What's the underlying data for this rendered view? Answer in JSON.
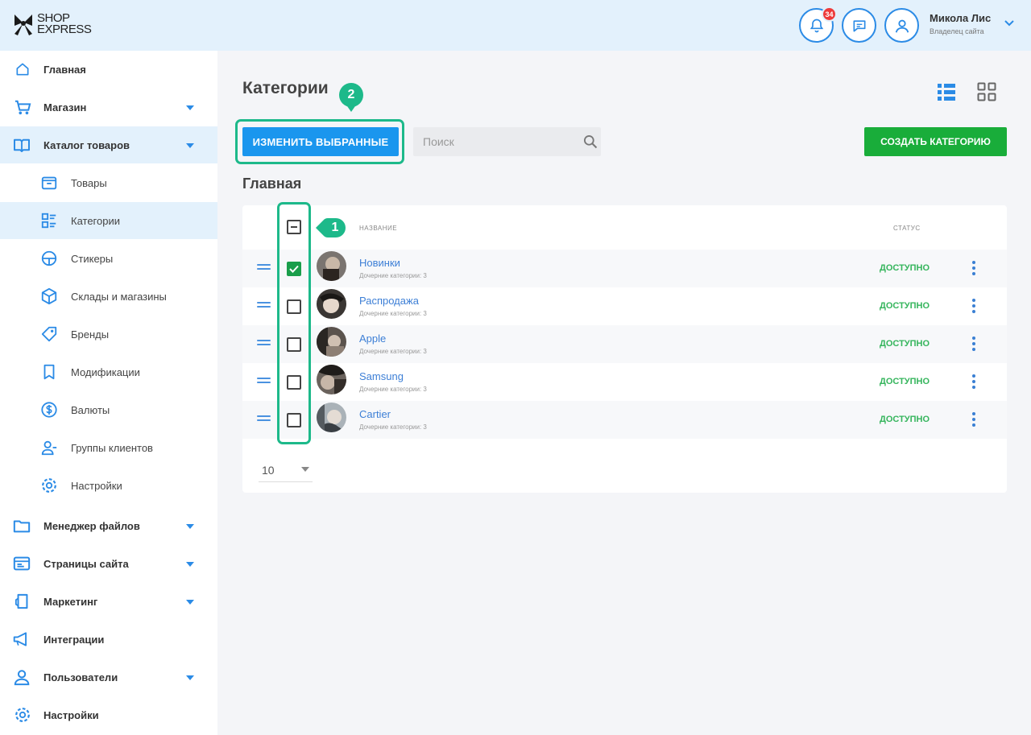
{
  "header": {
    "logo_line1": "SHOP",
    "logo_line2": "EXPRESS",
    "notifications_count": "34",
    "user_name": "Микола Лис",
    "user_role": "Владелец сайта",
    "icons": [
      "bell-icon",
      "chat-icon",
      "user-icon",
      "chevron-down-icon"
    ]
  },
  "sidebar": {
    "items": [
      {
        "label": "Главная",
        "icon": "home-icon"
      },
      {
        "label": "Магазин",
        "icon": "cart-icon"
      },
      {
        "label": "Каталог товаров",
        "icon": "book-icon"
      },
      {
        "label": "Товары",
        "icon": "box-icon"
      },
      {
        "label": "Категории",
        "icon": "categories-icon"
      },
      {
        "label": "Стикеры",
        "icon": "sticker-icon"
      },
      {
        "label": "Склады и магазины",
        "icon": "warehouse-icon"
      },
      {
        "label": "Бренды",
        "icon": "tag-icon"
      },
      {
        "label": "Модификации",
        "icon": "bookmark-icon"
      },
      {
        "label": "Валюты",
        "icon": "dollar-icon"
      },
      {
        "label": "Группы клиентов",
        "icon": "users-icon"
      },
      {
        "label": "Настройки",
        "icon": "gear-icon"
      },
      {
        "label": "Менеджер файлов",
        "icon": "folder-icon"
      },
      {
        "label": "Страницы сайта",
        "icon": "page-icon"
      },
      {
        "label": "Маркетинг",
        "icon": "marketing-icon"
      },
      {
        "label": "Интеграции",
        "icon": "megaphone-icon"
      },
      {
        "label": "Пользователи",
        "icon": "user-icon"
      },
      {
        "label": "Настройки",
        "icon": "gear-icon"
      }
    ]
  },
  "main": {
    "title": "Категории",
    "edit_selected_label": "ИЗМЕНИТЬ ВЫБРАННЫЕ",
    "search_placeholder": "Поиск",
    "create_label": "СОЗДАТЬ КАТЕГОРИЮ",
    "section_title": "Главная",
    "columns": {
      "name": "НАЗВАНИЕ",
      "status": "СТАТУС"
    },
    "rows": [
      {
        "name": "Новинки",
        "sub": "Дочерние категории: 3",
        "status": "ДОСТУПНО",
        "checked": true
      },
      {
        "name": "Распродажа",
        "sub": "Дочерние категории: 3",
        "status": "ДОСТУПНО",
        "checked": false
      },
      {
        "name": "Apple",
        "sub": "Дочерние категории: 3",
        "status": "ДОСТУПНО",
        "checked": false
      },
      {
        "name": "Samsung",
        "sub": "Дочерние категории: 3",
        "status": "ДОСТУПНО",
        "checked": false
      },
      {
        "name": "Cartier",
        "sub": "Дочерние категории: 3",
        "status": "ДОСТУПНО",
        "checked": false
      }
    ],
    "per_page": "10"
  },
  "annotations": {
    "marker1": "1",
    "marker2": "2"
  },
  "colors": {
    "accent": "#1a96ee",
    "create": "#19ad3a",
    "highlight": "#1db98a",
    "status": "#35b55c",
    "sidebar_active": "#e3f1fc"
  }
}
